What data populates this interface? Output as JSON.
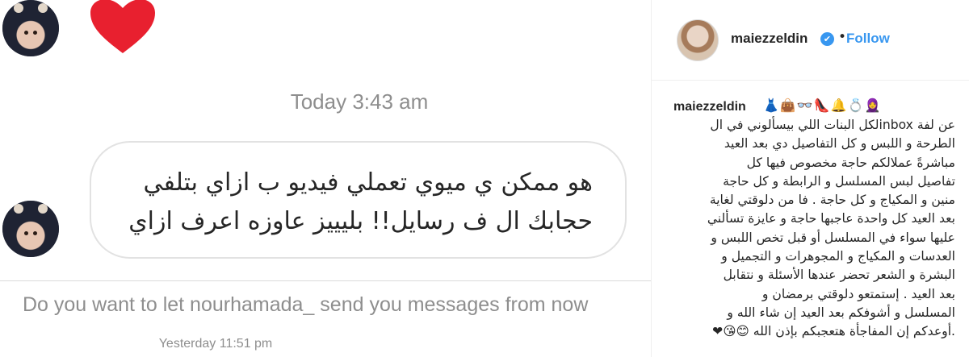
{
  "chat": {
    "today_label": "Today 3:43 am",
    "message_lines": [
      "هو ممكن ي ميوي تعملي فيديو ب ازاي بتلفي",
      "حجابك ال ف رسايل!! بليييز عاوزه اعرف ازاي"
    ],
    "request_text": "Do you want to let nourhamada_ send you messages from now",
    "yesterday_label": "Yesterday 11:51 pm",
    "heart_color": "#e8202f"
  },
  "post": {
    "username": "maiezzeldin",
    "dot": "•",
    "follow_label": "Follow",
    "verified_color": "#3897f0",
    "caption_user": "maiezzeldin",
    "caption_emojis": "👗👜👓👠🔔💍🧕",
    "caption_lines": [
      "عن لفة inboxلكل البنات اللي بيسألوني في ال",
      "الطرحة و اللبس و كل التفاصيل دي بعد العيد",
      "مباشرةً عملالكم حاجة مخصوص فيها كل",
      "تفاصيل لبس المسلسل و الرابطة و كل حاجة",
      "منين و المكياج و كل حاجة . فا من دلوقتي لغاية",
      "بعد العيد كل واحدة عاجبها حاجة و عايزة تسألني",
      "عليها سواء في المسلسل أو قبل تخص اللبس و",
      "العدسات و المكياج و المجوهرات و التجميل و",
      "البشرة و الشعر تحضر عندها الأسئلة و نتقابل",
      "بعد العيد . إستمتعو دلوقتي برمضان و",
      "المسلسل و أشوفكم بعد العيد إن شاء الله و",
      ".أوعدكم إن المفاجأة هتعجبكم بإذن الله 😊😘❤"
    ]
  }
}
